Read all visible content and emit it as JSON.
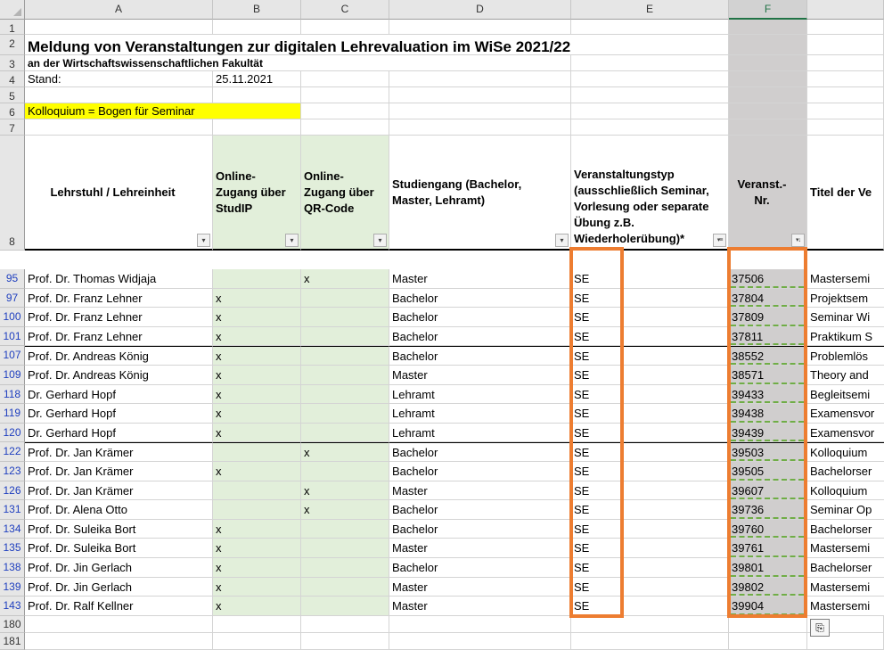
{
  "columns": [
    "A",
    "B",
    "C",
    "D",
    "E",
    "F"
  ],
  "selected_column": "F",
  "title": "Meldung von Veranstaltungen zur digitalen Lehrevaluation im WiSe 2021/22",
  "subtitle": "an der Wirtschaftswissenschaftlichen Fakultät",
  "stand_label": "Stand:",
  "stand_value": "25.11.2021",
  "note": "Kolloquium = Bogen für Seminar",
  "preamble_row_numbers": [
    "1",
    "2",
    "3",
    "4",
    "5",
    "6",
    "7",
    "8"
  ],
  "headers": {
    "a": "Lehrstuhl / Lehreinheit",
    "b": "Online-Zugang über StudIP",
    "c": "Online-Zugang über QR-Code",
    "d": "Studiengang (Bachelor, Master, Lehramt)",
    "e": "Veranstaltungstyp (ausschließlich Seminar, Vorlesung oder separate Übung z.B. Wiederholerübung)*",
    "f": "Veranst.-Nr.",
    "g": "Titel der Ve"
  },
  "filter_icons": {
    "a": "▾",
    "b": "▾",
    "c": "▾",
    "d": "▾",
    "e": "filter-active",
    "f": "sort-filter"
  },
  "rows": [
    {
      "row": "95",
      "a": "Prof. Dr. Thomas Widjaja",
      "b": "",
      "c": "x",
      "d": "Master",
      "e": "SE",
      "f": "37506",
      "g": "Mastersemi"
    },
    {
      "row": "97",
      "a": "Prof. Dr. Franz Lehner",
      "b": "x",
      "c": "",
      "d": "Bachelor",
      "e": "SE",
      "f": "37804",
      "g": "Projektsem"
    },
    {
      "row": "100",
      "a": "Prof. Dr. Franz Lehner",
      "b": "x",
      "c": "",
      "d": "Bachelor",
      "e": "SE",
      "f": "37809",
      "g": "Seminar Wi"
    },
    {
      "row": "101",
      "a": "Prof. Dr. Franz Lehner",
      "b": "x",
      "c": "",
      "d": "Bachelor",
      "e": "SE",
      "f": "37811",
      "g": "Praktikum S"
    },
    {
      "row": "107",
      "a": "Prof. Dr. Andreas König",
      "b": "x",
      "c": "",
      "d": "Bachelor",
      "e": "SE",
      "f": "38552",
      "g": "Problemlös"
    },
    {
      "row": "109",
      "a": "Prof. Dr. Andreas König",
      "b": "x",
      "c": "",
      "d": "Master",
      "e": "SE",
      "f": "38571",
      "g": "Theory and"
    },
    {
      "row": "118",
      "a": "Dr. Gerhard Hopf",
      "b": "x",
      "c": "",
      "d": "Lehramt",
      "e": "SE",
      "f": "39433",
      "g": "Begleitsemi"
    },
    {
      "row": "119",
      "a": "Dr. Gerhard Hopf",
      "b": "x",
      "c": "",
      "d": "Lehramt",
      "e": "SE",
      "f": "39438",
      "g": "Examensvor"
    },
    {
      "row": "120",
      "a": "Dr. Gerhard Hopf",
      "b": "x",
      "c": "",
      "d": "Lehramt",
      "e": "SE",
      "f": "39439",
      "g": "Examensvor"
    },
    {
      "row": "122",
      "a": "Prof. Dr. Jan Krämer",
      "b": "",
      "c": "x",
      "d": "Bachelor",
      "e": "SE",
      "f": "39503",
      "g": "Kolloquium"
    },
    {
      "row": "123",
      "a": "Prof. Dr. Jan Krämer",
      "b": "x",
      "c": "",
      "d": "Bachelor",
      "e": "SE",
      "f": "39505",
      "g": "Bachelorser"
    },
    {
      "row": "126",
      "a": "Prof. Dr. Jan Krämer",
      "b": "",
      "c": "x",
      "d": "Master",
      "e": "SE",
      "f": "39607",
      "g": "Kolloquium"
    },
    {
      "row": "131",
      "a": "Prof. Dr. Alena Otto",
      "b": "",
      "c": "x",
      "d": "Bachelor",
      "e": "SE",
      "f": "39736",
      "g": "Seminar Op"
    },
    {
      "row": "134",
      "a": "Prof. Dr. Suleika Bort",
      "b": "x",
      "c": "",
      "d": "Bachelor",
      "e": "SE",
      "f": "39760",
      "g": "Bachelorser"
    },
    {
      "row": "135",
      "a": "Prof. Dr. Suleika Bort",
      "b": "x",
      "c": "",
      "d": "Master",
      "e": "SE",
      "f": "39761",
      "g": "Mastersemi"
    },
    {
      "row": "138",
      "a": "Prof. Dr. Jin Gerlach",
      "b": "x",
      "c": "",
      "d": "Bachelor",
      "e": "SE",
      "f": "39801",
      "g": "Bachelorser"
    },
    {
      "row": "139",
      "a": "Prof. Dr. Jin Gerlach",
      "b": "x",
      "c": "",
      "d": "Master",
      "e": "SE",
      "f": "39802",
      "g": "Mastersemi"
    },
    {
      "row": "143",
      "a": "Prof. Dr. Ralf Kellner",
      "b": "x",
      "c": "",
      "d": "Master",
      "e": "SE",
      "f": "39904",
      "g": "Mastersemi"
    }
  ],
  "trailing_row_numbers": [
    "180",
    "181"
  ],
  "paste_options_icon": "paste-options-icon",
  "colors": {
    "accent_orange": "#ed7d31",
    "green_fill": "#e2efda",
    "gray_fill": "#d0cece",
    "highlight_yellow": "#ffff00",
    "excel_green": "#217346"
  }
}
